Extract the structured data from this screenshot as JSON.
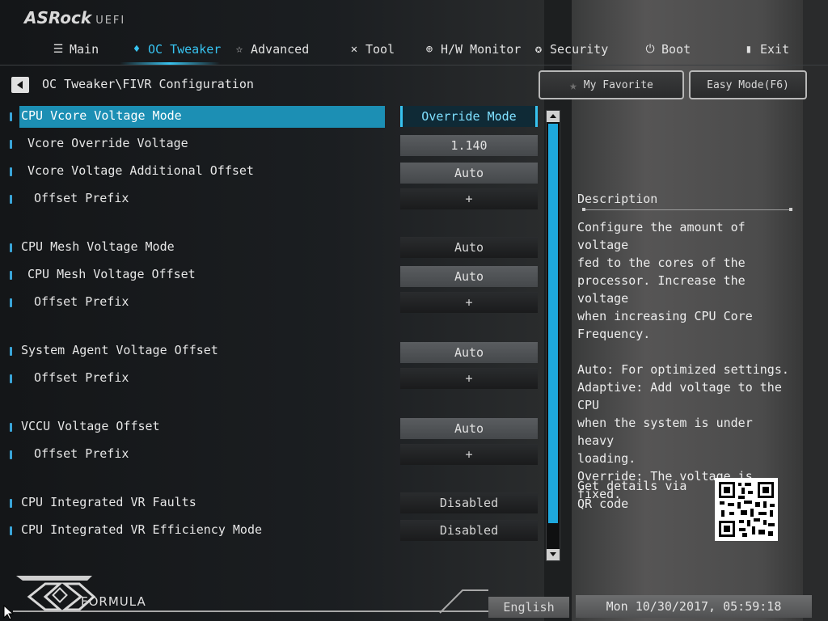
{
  "brand": {
    "name": "ASRock",
    "suffix": "UEFI"
  },
  "nav": {
    "tabs": [
      {
        "label": "Main",
        "icon": "list-icon"
      },
      {
        "label": "OC Tweaker",
        "icon": "flame-icon",
        "active": true
      },
      {
        "label": "Advanced",
        "icon": "star-icon"
      },
      {
        "label": "Tool",
        "icon": "tools-icon"
      },
      {
        "label": "H/W Monitor",
        "icon": "globe-icon"
      },
      {
        "label": "Security",
        "icon": "shield-icon"
      },
      {
        "label": "Boot",
        "icon": "power-icon"
      },
      {
        "label": "Exit",
        "icon": "exit-door-icon"
      }
    ]
  },
  "breadcrumb": "OC Tweaker\\FIVR Configuration",
  "buttons": {
    "favorite": "My Favorite",
    "easy_mode": "Easy Mode(F6)"
  },
  "settings": [
    {
      "label": "CPU Vcore Voltage Mode",
      "value": "Override Mode"
    },
    {
      "label": "Vcore Override Voltage",
      "value": "1.140"
    },
    {
      "label": "Vcore Voltage Additional Offset",
      "value": "Auto"
    },
    {
      "label": "Offset Prefix",
      "value": "+"
    },
    {
      "label": "CPU Mesh Voltage Mode",
      "value": "Auto"
    },
    {
      "label": "CPU Mesh Voltage Offset",
      "value": "Auto"
    },
    {
      "label": "Offset Prefix",
      "value": "+"
    },
    {
      "label": "System Agent Voltage Offset",
      "value": "Auto"
    },
    {
      "label": "Offset Prefix",
      "value": "+"
    },
    {
      "label": "VCCU Voltage Offset",
      "value": "Auto"
    },
    {
      "label": "Offset Prefix",
      "value": "+"
    },
    {
      "label": "CPU Integrated VR Faults",
      "value": "Disabled"
    },
    {
      "label": "CPU Integrated VR Efficiency Mode",
      "value": "Disabled"
    }
  ],
  "description": {
    "title": "Description",
    "text": "Configure the amount of voltage\nfed to the cores of the\nprocessor. Increase the voltage\nwhen increasing CPU Core\nFrequency.\n\nAuto: For optimized settings.\nAdaptive: Add voltage to the CPU\nwhen the system is under heavy\nloading.\nOverride: The voltage is fixed.",
    "qr_text": "Get details via QR code"
  },
  "footer": {
    "logo_text": "FORMULA",
    "language": "English",
    "datetime": "Mon 10/30/2017, 05:59:18"
  },
  "colors": {
    "accent": "#37c3f0",
    "selection": "#1c8fb4"
  }
}
